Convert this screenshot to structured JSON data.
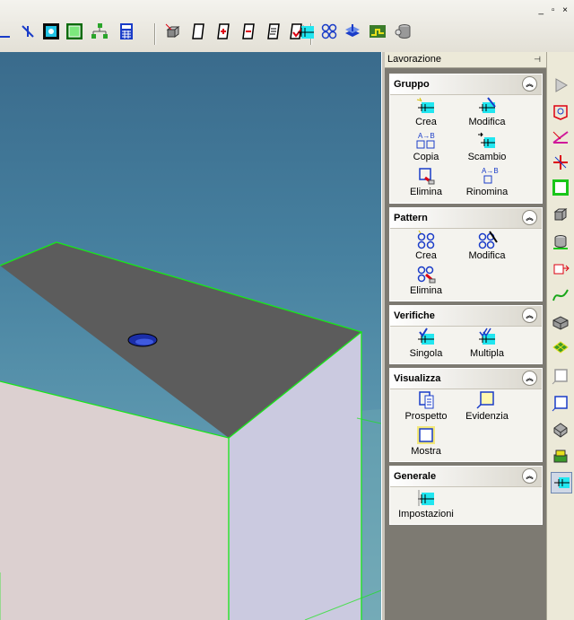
{
  "window": {
    "controls": "_ ▫ ×"
  },
  "panel": {
    "title": "Lavorazione",
    "pin_icon": "pin-icon",
    "groups": [
      {
        "title": "Gruppo",
        "items": [
          {
            "label": "Crea",
            "icon": "hole-create-icon"
          },
          {
            "label": "Modifica",
            "icon": "hole-edit-icon"
          },
          {
            "label": "Copia",
            "icon": "copy-icon"
          },
          {
            "label": "Scambio",
            "icon": "swap-icon"
          },
          {
            "label": "Elimina",
            "icon": "delete-icon"
          },
          {
            "label": "Rinomina",
            "icon": "rename-icon"
          }
        ]
      },
      {
        "title": "Pattern",
        "items": [
          {
            "label": "Crea",
            "icon": "pattern-create-icon"
          },
          {
            "label": "Modifica",
            "icon": "pattern-edit-icon"
          },
          {
            "label": "Elimina",
            "icon": "pattern-delete-icon"
          }
        ]
      },
      {
        "title": "Verifiche",
        "items": [
          {
            "label": "Singola",
            "icon": "check-single-icon"
          },
          {
            "label": "Multipla",
            "icon": "check-multiple-icon"
          }
        ]
      },
      {
        "title": "Visualizza",
        "items": [
          {
            "label": "Prospetto",
            "icon": "report-icon"
          },
          {
            "label": "Evidenzia",
            "icon": "highlight-icon"
          },
          {
            "label": "Mostra",
            "icon": "show-icon"
          }
        ]
      },
      {
        "title": "Generale",
        "items": [
          {
            "label": "Impostazioni",
            "icon": "settings-icon"
          }
        ]
      }
    ]
  },
  "colors": {
    "accent": "#21e6f0",
    "edge": "#19e619",
    "face_top": "#5c5c5c",
    "face_front": "#dcd0d0",
    "face_side": "#cbcae0"
  }
}
